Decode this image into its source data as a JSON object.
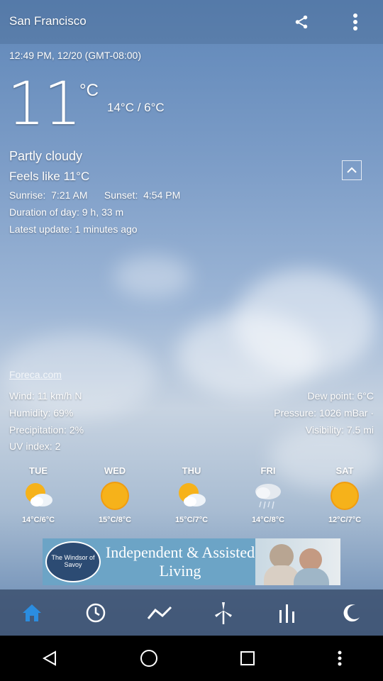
{
  "header": {
    "city": "San Francisco",
    "share_icon": "share-icon",
    "more_icon": "more-vertical-icon"
  },
  "datetime": "12:49 PM, 12/20 (GMT-08:00)",
  "current": {
    "temp": "11",
    "unit": "°C",
    "hilo": "14°C / 6°C",
    "condition": "Partly cloudy",
    "feels_like": "Feels like 11°C",
    "sunrise_label": "Sunrise:",
    "sunrise": "7:21 AM",
    "sunset_label": "Sunset:",
    "sunset": "4:54 PM",
    "duration_label": "Duration of day:",
    "duration": "9 h, 33 m",
    "update_label": "Latest update:",
    "update": "1 minutes ago"
  },
  "source": "Foreca.com",
  "details": {
    "wind_label": "Wind:",
    "wind": "11 km/h N",
    "humidity_label": "Humidity:",
    "humidity": "69%",
    "precip_label": "Precipitation:",
    "precip": "2%",
    "uv_label": "UV index:",
    "uv": "2",
    "dew_label": "Dew point:",
    "dew": "6°C",
    "pressure_label": "Pressure:",
    "pressure": "1026 mBar ·",
    "visibility_label": "Visibility:",
    "visibility": "7.5 mi"
  },
  "forecast": [
    {
      "day": "TUE",
      "temp": "14°C/6°C",
      "icon": "partly-cloudy-icon"
    },
    {
      "day": "WED",
      "temp": "15°C/8°C",
      "icon": "sunny-icon"
    },
    {
      "day": "THU",
      "temp": "15°C/7°C",
      "icon": "partly-cloudy-icon"
    },
    {
      "day": "FRI",
      "temp": "14°C/8°C",
      "icon": "rain-icon"
    },
    {
      "day": "SAT",
      "temp": "12°C/7°C",
      "icon": "sunny-icon"
    }
  ],
  "ad": {
    "logo": "The Windsor of Savoy",
    "text": "Independent & Assisted Living"
  },
  "nav": [
    "home-icon",
    "clock-icon",
    "chart-line-icon",
    "wind-turbine-icon",
    "bar-chart-icon",
    "moon-icon"
  ],
  "colors": {
    "nav_active": "#2b8de0"
  }
}
